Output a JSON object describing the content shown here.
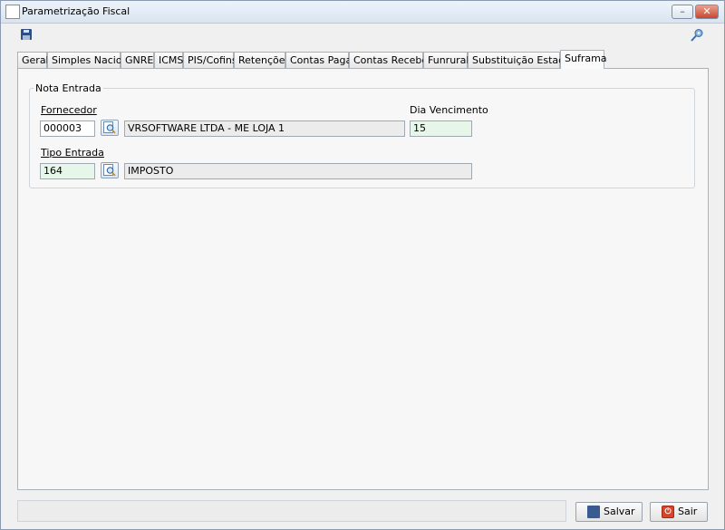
{
  "window": {
    "title": "Parametrização Fiscal",
    "minimize_label": "–",
    "close_label": "✕"
  },
  "toolbar": {
    "save_icon": "save-icon",
    "search_icon": "key-search-icon"
  },
  "tabs": [
    {
      "label": "Geral",
      "active": false
    },
    {
      "label": "Simples Nacional",
      "active": false
    },
    {
      "label": "GNRE",
      "active": false
    },
    {
      "label": "ICMS",
      "active": false
    },
    {
      "label": "PIS/Cofins",
      "active": false
    },
    {
      "label": "Retenções",
      "active": false
    },
    {
      "label": "Contas Pagar",
      "active": false
    },
    {
      "label": "Contas Receber",
      "active": false
    },
    {
      "label": "Funrural",
      "active": false
    },
    {
      "label": "Substituição Estadual",
      "active": false
    },
    {
      "label": "Suframa",
      "active": true
    }
  ],
  "nota_entrada": {
    "legend": "Nota Entrada",
    "fornecedor_label": "Fornecedor",
    "fornecedor_code": "000003",
    "fornecedor_name": "VRSOFTWARE LTDA - ME LOJA 1",
    "dia_vencimento_label": "Dia Vencimento",
    "dia_vencimento": "15",
    "tipo_entrada_label": "Tipo Entrada",
    "tipo_entrada_code": "164",
    "tipo_entrada_name": "IMPOSTO"
  },
  "footer": {
    "save_label": "Salvar",
    "exit_label": "Sair"
  },
  "colors": {
    "green_field": "#e6f7e9",
    "title_bar": "#d9e4f1",
    "close_button": "#c9472f"
  }
}
